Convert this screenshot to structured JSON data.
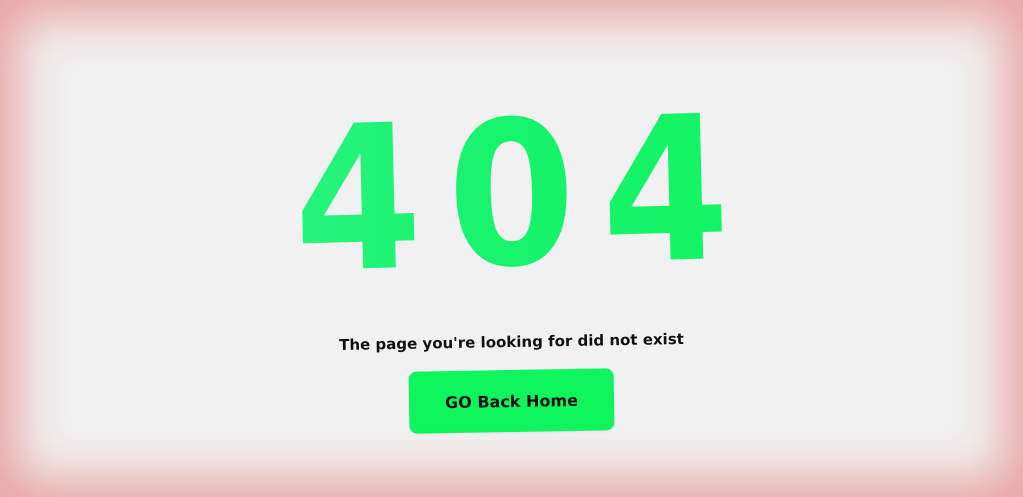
{
  "error": {
    "code": "404",
    "message": "The page you're looking for did not exist",
    "button_label": "GO Back Home"
  },
  "colors": {
    "accent": "#0ef55d",
    "accent_light": "#38f58f",
    "background": "#f1f1f1",
    "vignette": "#e89696",
    "text": "#111111"
  }
}
